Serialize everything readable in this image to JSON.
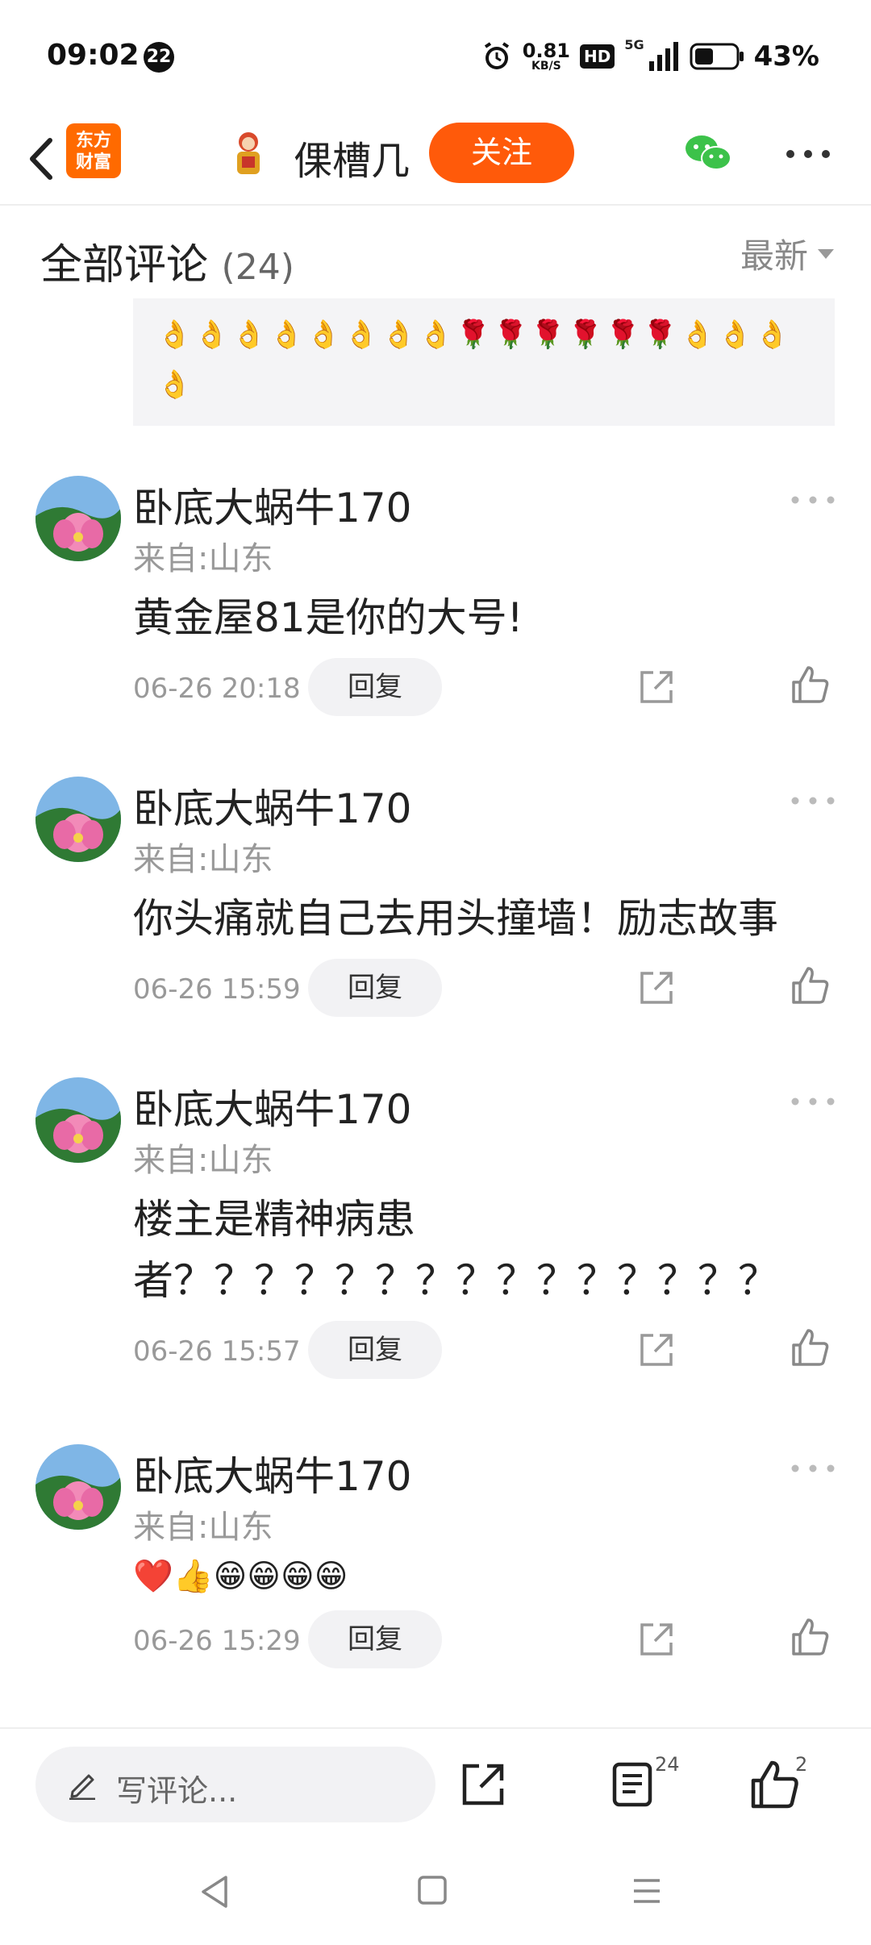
{
  "status_bar": {
    "time": "09:02",
    "notification_count": "22",
    "net_speed_value": "0.81",
    "net_speed_unit": "KB/S",
    "hd_label": "HD",
    "network": "5G",
    "battery_percent": "43%",
    "battery_level": 0.43
  },
  "header": {
    "app_logo_text_1": "东方",
    "app_logo_text_2": "财富",
    "user_name": "倮槽几",
    "follow_label": "关注",
    "brand_color": "#ff5a0a"
  },
  "comments_section": {
    "title": "全部评论",
    "count": "(24)",
    "sort_label": "最新"
  },
  "quoted": {
    "emoji_text": "👌👌👌👌👌👌👌👌🌹🌹🌹🌹🌹🌹👌👌👌👌"
  },
  "comments": [
    {
      "author": "卧底大蜗牛170",
      "location": "来自:山东",
      "text": "黄金屋81是你的大号!",
      "time": "06-26 20:18",
      "reply_label": "回复"
    },
    {
      "author": "卧底大蜗牛170",
      "location": "来自:山东",
      "text": "你头痛就自己去用头撞墙！励志故事",
      "time": "06-26 15:59",
      "reply_label": "回复"
    },
    {
      "author": "卧底大蜗牛170",
      "location": "来自:山东",
      "text_line_1": "楼主是精神病患",
      "text_line_2": "者？？？？？？？？？？？？？？？",
      "time": "06-26 15:57",
      "reply_label": "回复"
    },
    {
      "author": "卧底大蜗牛170",
      "location": "来自:山东",
      "text": "❤️👍😁😁😁😁",
      "time": "06-26 15:29",
      "reply_label": "回复"
    }
  ],
  "bottom_bar": {
    "input_placeholder": "写评论...",
    "comment_count": "24",
    "like_count": "2"
  }
}
